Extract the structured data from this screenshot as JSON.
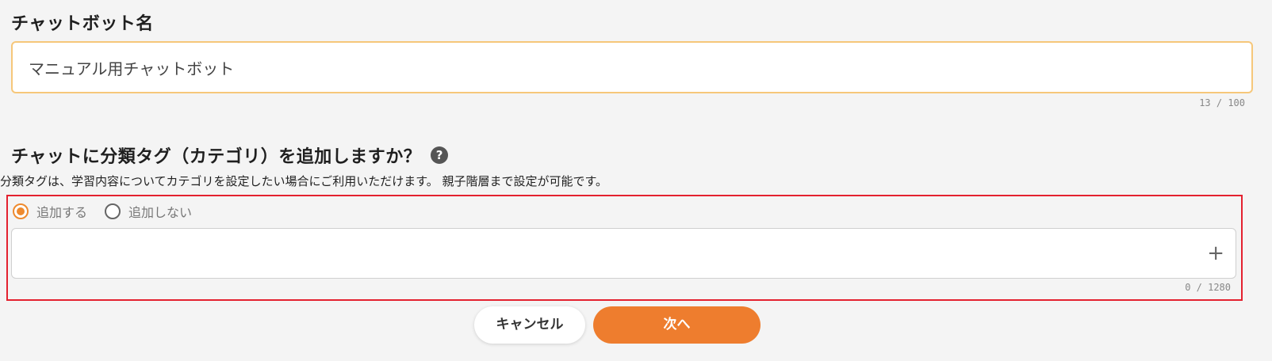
{
  "chatbot_name": {
    "label": "チャットボット名",
    "value": "マニュアル用チャットボット",
    "counter": "13 / 100"
  },
  "category_tag": {
    "question": "チャットに分類タグ（カテゴリ）を追加しますか？",
    "help_icon": "?",
    "description": "分類タグは、学習内容についてカテゴリを設定したい場合にご利用いただけます。 親子階層まで設定が可能です。",
    "options": [
      {
        "label": "追加する",
        "selected": true
      },
      {
        "label": "追加しない",
        "selected": false
      }
    ],
    "input_value": "",
    "add_icon": "+",
    "counter": "0 / 1280"
  },
  "buttons": {
    "cancel_label": "キャンセル",
    "next_label": "次へ"
  },
  "colors": {
    "accent": "#ee7d2e",
    "highlight_border": "#e4212f",
    "field_focus_border": "#f6c77a"
  }
}
